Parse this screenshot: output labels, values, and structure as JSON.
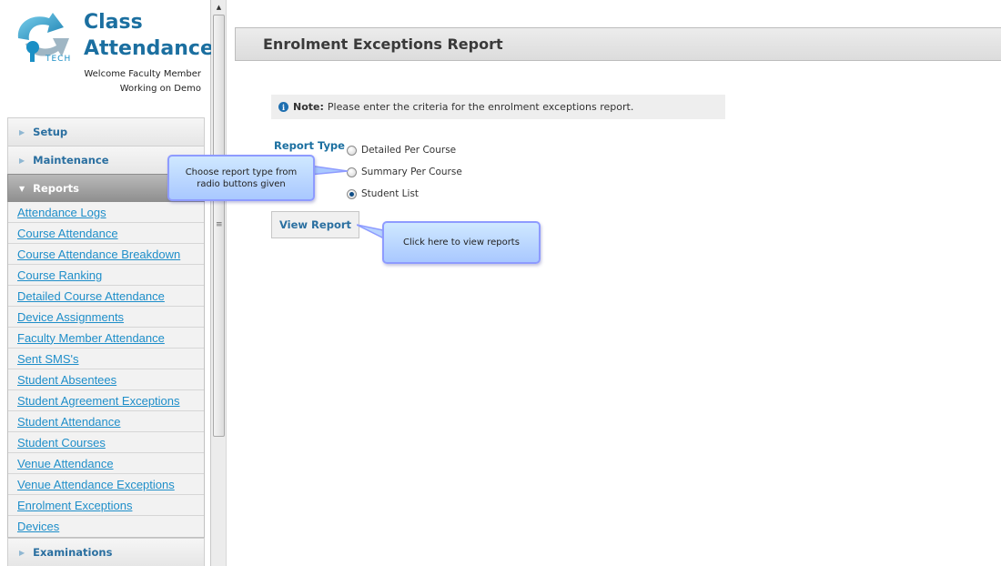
{
  "app": {
    "title_line1": "Class",
    "title_line2": "Attendance",
    "logo_text": "TECH",
    "welcome": "Welcome Faculty Member",
    "working_on": "Working on Demo"
  },
  "sidebar": {
    "sections": [
      {
        "label": "Setup",
        "expanded": false
      },
      {
        "label": "Maintenance",
        "expanded": false
      },
      {
        "label": "Reports",
        "expanded": true
      },
      {
        "label": "Examinations",
        "expanded": false
      }
    ],
    "report_links": [
      "Attendance Logs",
      "Course Attendance",
      "Course Attendance Breakdown",
      "Course Ranking",
      "Detailed Course Attendance",
      "Device Assignments",
      "Faculty Member Attendance",
      "Sent SMS's",
      "Student Absentees",
      "Student Agreement Exceptions",
      "Student Attendance",
      "Student Courses",
      "Venue Attendance",
      "Venue Attendance Exceptions",
      "Enrolment Exceptions",
      "Devices"
    ]
  },
  "main": {
    "page_title": "Enrolment Exceptions Report",
    "note_label": "Note:",
    "note_text": "Please enter the criteria for the enrolment exceptions report.",
    "report_type_label": "Report Type",
    "report_types": [
      {
        "label": "Detailed Per Course",
        "checked": false
      },
      {
        "label": "Summary Per Course",
        "checked": false
      },
      {
        "label": "Student List",
        "checked": true
      }
    ],
    "view_button": "View Report"
  },
  "callouts": {
    "radio_hint": "Choose report type from radio buttons given",
    "button_hint": "Click here to view reports"
  },
  "colors": {
    "brand_blue": "#1b6fa0",
    "link_blue": "#1e8ec9",
    "callout_border": "#8e9bff"
  }
}
